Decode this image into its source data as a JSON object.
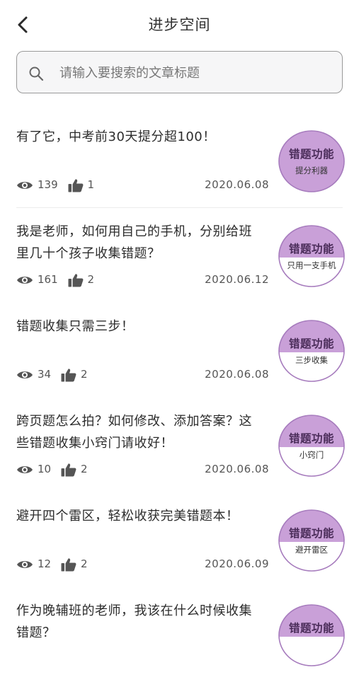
{
  "header": {
    "title": "进步空间"
  },
  "search": {
    "placeholder": "请输入要搜索的文章标题"
  },
  "colors": {
    "accent": "#c9a0d8",
    "accent_dark": "#a67bbd"
  },
  "articles": [
    {
      "title": "有了它，中考前30天提分超100！",
      "views": "139",
      "likes": "1",
      "date": "2020.06.08",
      "tag": "错题功能",
      "subtitle": "提分利器",
      "filled": true
    },
    {
      "title": "我是老师，如何用自己的手机，分别给班里几十个孩子收集错题？",
      "views": "161",
      "likes": "2",
      "date": "2020.06.12",
      "tag": "错题功能",
      "subtitle": "只用一支手机",
      "filled": false
    },
    {
      "title": "错题收集只需三步！",
      "views": "34",
      "likes": "2",
      "date": "2020.06.08",
      "tag": "错题功能",
      "subtitle": "三步收集",
      "filled": false
    },
    {
      "title": "跨页题怎么拍？如何修改、添加答案？这些错题收集小窍门请收好！",
      "views": "10",
      "likes": "2",
      "date": "2020.06.08",
      "tag": "错题功能",
      "subtitle": "小窍门",
      "filled": false
    },
    {
      "title": "避开四个雷区，轻松收获完美错题本！",
      "views": "12",
      "likes": "2",
      "date": "2020.06.09",
      "tag": "错题功能",
      "subtitle": "避开雷区",
      "filled": false
    },
    {
      "title": "作为晚辅班的老师，我该在什么时候收集错题？",
      "views": "",
      "likes": "",
      "date": "",
      "tag": "错题功能",
      "subtitle": "",
      "filled": false
    }
  ]
}
